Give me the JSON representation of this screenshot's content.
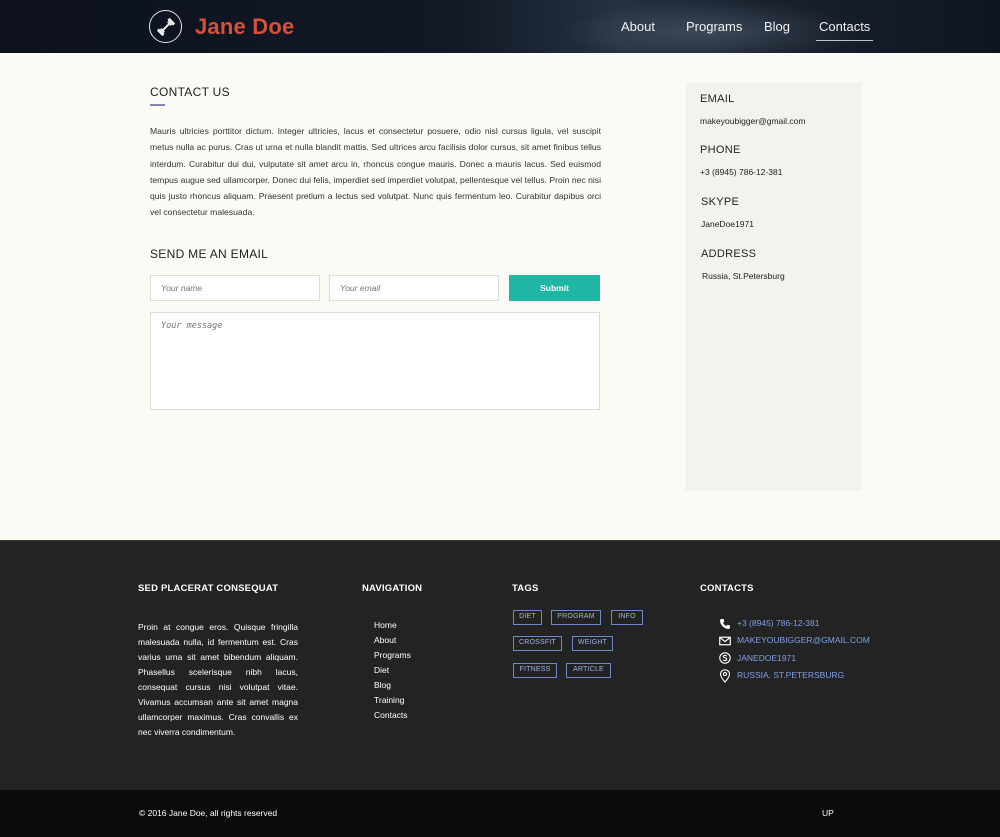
{
  "header": {
    "logo_text": "Jane Doe",
    "nav": [
      "About",
      "Programs",
      "Blog",
      "Contacts"
    ],
    "active_nav": "Contacts"
  },
  "contact": {
    "title": "CONTACT US",
    "intro": "Mauris ultricies porttitor dictum. Integer ultricies, lacus et consectetur posuere, odio nisl cursus ligula, vel suscipit metus nulla ac purus. Cras ut urna et nulla blandit mattis. Sed ultrices arcu facilisis dolor cursus, sit amet finibus tellus interdum. Curabitur dui dui, vulputate sit amet arcu in, rhoncus congue mauris. Donec a mauris lacus. Sed euismod tempus augue sed ullamcorper. Donec dui felis, imperdiet sed imperdiet volutpat, pellentesque vel tellus. Proin nec nisi quis justo rhoncus aliquam. Praesent pretium a lectus sed volutpat. Nunc quis fermentum leo. Curabitur dapibus orci vel consectetur malesuada."
  },
  "form": {
    "title": "SEND ME AN EMAIL",
    "name_placeholder": "Your name",
    "email_placeholder": "Your email",
    "message_placeholder": "Your message",
    "submit_label": "Submit"
  },
  "sidebar": {
    "email_label": "EMAIL",
    "email_value": "makeyoubigger@gmail.com",
    "phone_label": "PHONE",
    "phone_value": "+3 (8945) 786-12-381",
    "skype_label": "SKYPE",
    "skype_value": "JaneDoe1971",
    "address_label": "ADDRESS",
    "address_value": "Russia, St.Petersburg"
  },
  "footer": {
    "about_title": "SED PLACERAT CONSEQUAT",
    "about_text": "Proin at congue eros. Quisque fringilla malesuada nulla, id fermentum est. Cras varius urna sit amet bibendum aliquam. Phasellus scelerisque nibh lacus, consequat cursus nisi volutpat vitae. Vivamus accumsan ante sit amet magna ullamcorper maximus. Cras convallis ex nec viverra condimentum.",
    "nav_title": "NAVIGATION",
    "nav_items": [
      "Home",
      "About",
      "Programs",
      "Diet",
      "Blog",
      "Training",
      "Contacts"
    ],
    "tags_title": "TAGS",
    "tags": [
      "DIET",
      "PROGRAM",
      "INFO",
      "CROSSFIT",
      "WEIGHT",
      "FITNESS",
      "ARTICLE"
    ],
    "contacts_title": "CONTACTS",
    "phone": "+3 (8945) 786-12-381",
    "email": "MAKEYOUBIGGER@GMAIL.COM",
    "skype": "JANEDOE1971",
    "address": "RUSSIA, ST.PETERSBURG",
    "icons": [
      "phone-icon",
      "envelope-icon",
      "skype-icon",
      "location-pin-icon"
    ],
    "link_color": "#7fa0e6"
  },
  "bottom": {
    "copyright": "© 2016 Jane Doe, all rights reserved",
    "up_label": "UP"
  },
  "colors": {
    "accent": "#1fb6a4",
    "logo": "#d9503a",
    "tag_border": "#6f86c9"
  }
}
